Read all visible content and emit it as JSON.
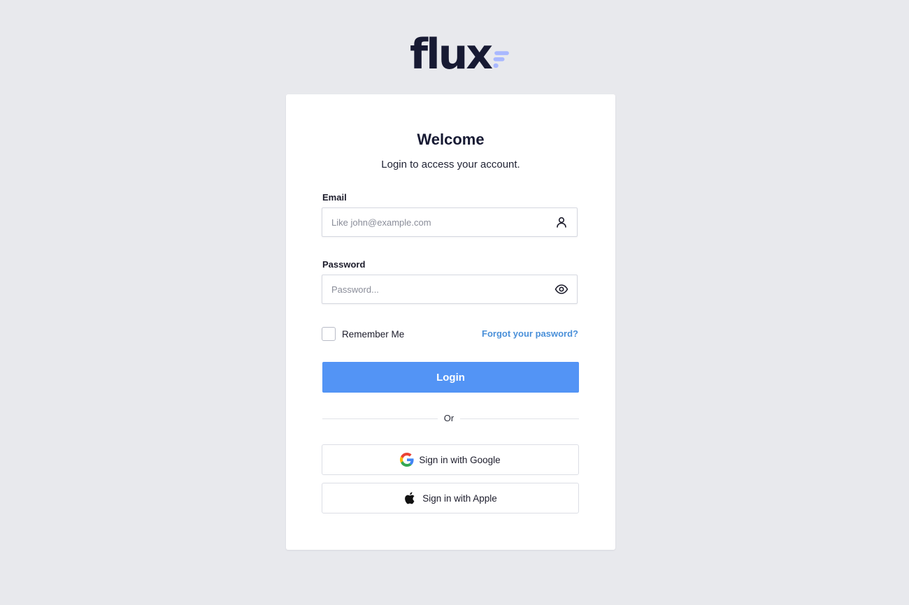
{
  "brand": {
    "name": "flux",
    "accent": "#a9b8ff"
  },
  "card": {
    "title": "Welcome",
    "subtitle": "Login to access your account."
  },
  "email": {
    "label": "Email",
    "placeholder": "Like john@example.com",
    "value": "",
    "icon": "user-icon"
  },
  "password": {
    "label": "Password",
    "placeholder": "Password...",
    "value": "",
    "icon": "eye-icon"
  },
  "remember": {
    "label": "Remember Me",
    "checked": false
  },
  "forgot": {
    "label": "Forgot your pasword?"
  },
  "login": {
    "label": "Login",
    "color": "#5394f5"
  },
  "divider": {
    "label": "Or"
  },
  "social": {
    "google_label": "Sign in with Google",
    "apple_label": "Sign in with Apple"
  }
}
